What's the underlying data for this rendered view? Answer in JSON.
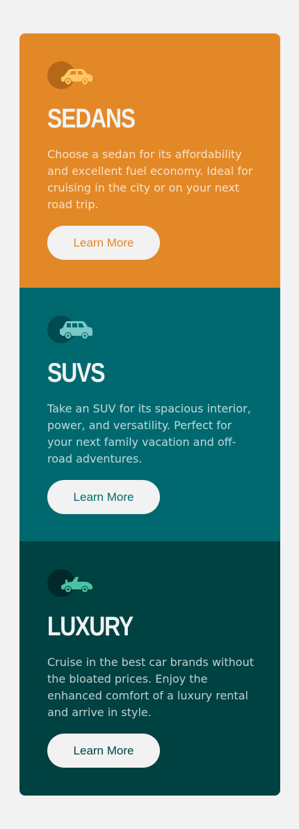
{
  "cards": [
    {
      "title": "SEDANS",
      "description": "Choose a sedan for its affordability and excellent fuel economy. Ideal for cruising in the city or on your next road trip.",
      "button_label": "Learn More",
      "icon": "sedan-car-icon",
      "accent_color": "#e38826"
    },
    {
      "title": "SUVS",
      "description": "Take an SUV for its spacious interior, power, and versatility. Perfect for your next family vacation and off-road adventures.",
      "button_label": "Learn More",
      "icon": "suv-car-icon",
      "accent_color": "#006970"
    },
    {
      "title": "LUXURY",
      "description": "Cruise in the best car brands without the bloated prices. Enjoy the enhanced comfort of a luxury rental and arrive in style.",
      "button_label": "Learn More",
      "icon": "luxury-car-icon",
      "accent_color": "#004141"
    }
  ],
  "colors": {
    "page_background": "#f2f2f2",
    "sedans_background": "#e38826",
    "suvs_background": "#006970",
    "luxury_background": "#004141",
    "heading_text": "#f2f2f2"
  }
}
